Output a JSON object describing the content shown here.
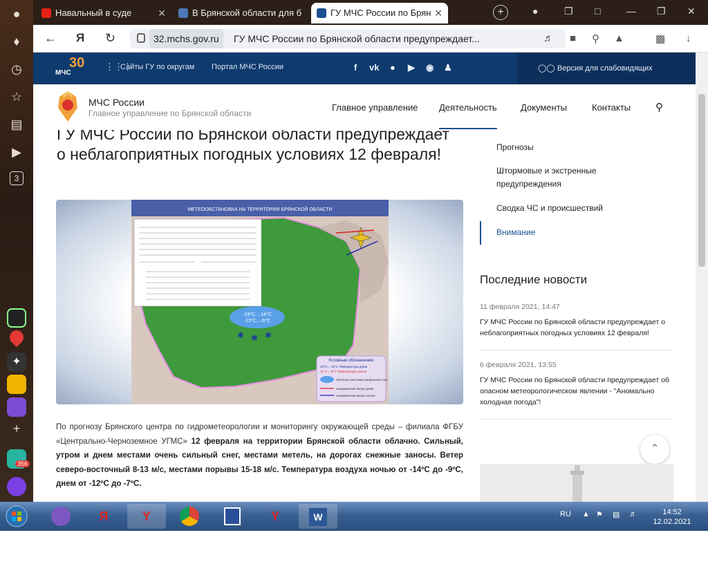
{
  "browser": {
    "tabs": [
      {
        "label": "Навальный в суде",
        "active": false
      },
      {
        "label": "В Брянской области для б",
        "active": false
      },
      {
        "label": "ГУ МЧС России по Брян",
        "active": true
      }
    ],
    "url_domain": "32.mchs.gov.ru",
    "url_title": "ГУ МЧС России по Брянской области предупреждает..."
  },
  "sidebar": {
    "badge_count": "3",
    "app_badge": "356"
  },
  "topbar": {
    "logo_number": "30",
    "logo_text": "МЧС",
    "sites_link": "Сайты ГУ по округам",
    "portal_link": "Портал МЧС России",
    "accessibility": "Версия для слабовидящих"
  },
  "header": {
    "org_name": "МЧС России",
    "org_sub": "Главное управление по Брянской области",
    "nav": [
      "Главное управление",
      "Деятельность",
      "Документы",
      "Контакты"
    ]
  },
  "article": {
    "title": "ГУ МЧС России по Брянской области предупреждает о неблагоприятных погодных условиях 12 февраля!",
    "map_title": "МЕТЕООБСТАНОВКА НА ТЕРРИТОРИИ БРЯНСКОЙ ОБЛАСТИ",
    "map_temp1": "-19°C...-14°C",
    "map_temp2": "-15°C...-6°C",
    "legend_title": "Условные обозначения:",
    "legend_day": "-19°C...-12°C Температура днем",
    "legend_night": "-11°C...-6°C Температура ночью",
    "legend_cloud": "Облачно, местами умеренный снег",
    "legend_wind_day": "Направление ветра днём",
    "legend_wind_night": "Направление ветра ночью",
    "para_plain": "По прогнозу Брянского центра по гидрометеорологии и мониторингу окружающей среды – филиала ФГБУ «Центрально-Черноземное УГМС» ",
    "para_bold": "12 февраля на территории Брянской области облачно. Сильный, утром и днем местами очень сильный снег, местами метель, на дорогах снежные заносы. Ветер северо-восточный 8-13 м/с, местами порывы  15-18 м/с. Температура воздуха ночью от -14ºС до -9ºС, днем от -12ºС до -7ºС."
  },
  "right": {
    "links": [
      "Прогнозы",
      "Штормовые и экстренные предупреждения",
      "Сводка ЧС и происшествий",
      "Внимание"
    ],
    "news_heading": "Последние новости",
    "news": [
      {
        "date": "11 февраля 2021, 14:47",
        "text": "ГУ МЧС России по Брянской области предупреждает о неблагоприятных погодных условиях 12 февраля!"
      },
      {
        "date": "6 февраля 2021, 13:55",
        "text": "ГУ МЧС России по Брянской области предупреждает об опасном метеорологическом явлении - \"Аномально холодная погода\"!"
      }
    ]
  },
  "taskbar": {
    "lang": "RU",
    "time": "14:52",
    "date": "12.02.2021"
  },
  "colors": {
    "mchs_blue": "#0e3a6d",
    "accent": "#1b4f8f",
    "map_green": "#3f9a3c"
  }
}
